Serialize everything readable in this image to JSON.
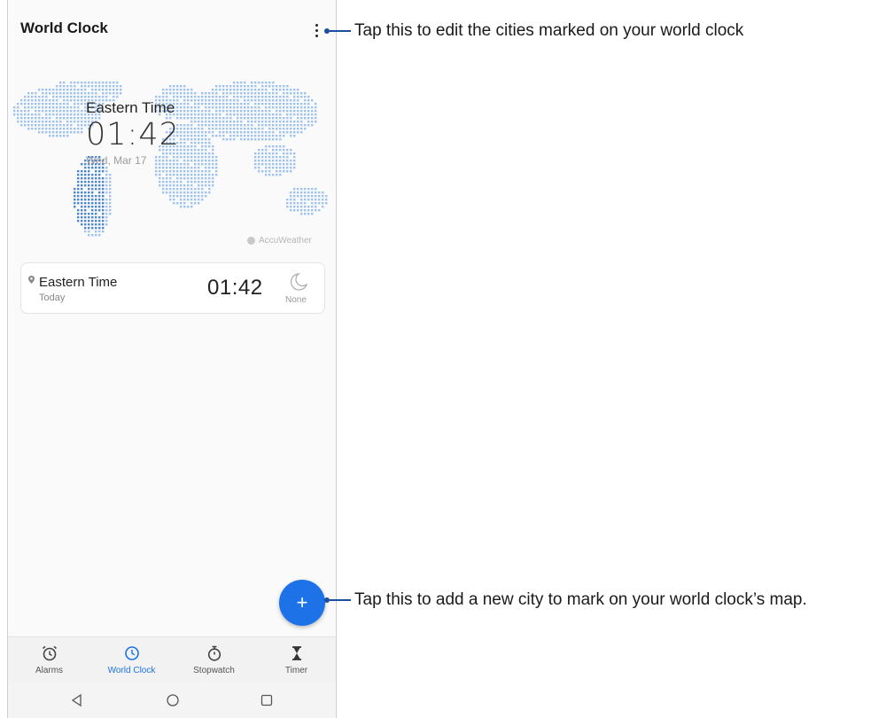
{
  "appbar": {
    "title": "World Clock",
    "menu_icon": "more-vert-icon"
  },
  "map": {
    "city": "Eastern Time",
    "time": "01:42",
    "date": "Wed, Mar 17",
    "credit": "AccuWeather"
  },
  "clock_list": [
    {
      "city": "Eastern Time",
      "day": "Today",
      "time": "01:42",
      "weather_label": "None",
      "weather_icon": "moon-icon"
    }
  ],
  "fab": {
    "label": "+",
    "icon": "add-icon"
  },
  "tabs": [
    {
      "label": "Alarms",
      "icon": "alarm-icon",
      "active": false
    },
    {
      "label": "World Clock",
      "icon": "clock-icon",
      "active": true
    },
    {
      "label": "Stopwatch",
      "icon": "stopwatch-icon",
      "active": false
    },
    {
      "label": "Timer",
      "icon": "hourglass-icon",
      "active": false
    }
  ],
  "nav": {
    "back_icon": "back-icon",
    "home_icon": "home-icon",
    "recents_icon": "recents-icon"
  },
  "callouts": {
    "menu": "Tap this to edit the cities marked on your world clock",
    "add": "Tap this to add a new city to mark on your world clock’s map."
  },
  "colors": {
    "accent": "#1d72e8",
    "map_dots": "#9ec3f2",
    "callout_line": "#1a4fa0"
  }
}
